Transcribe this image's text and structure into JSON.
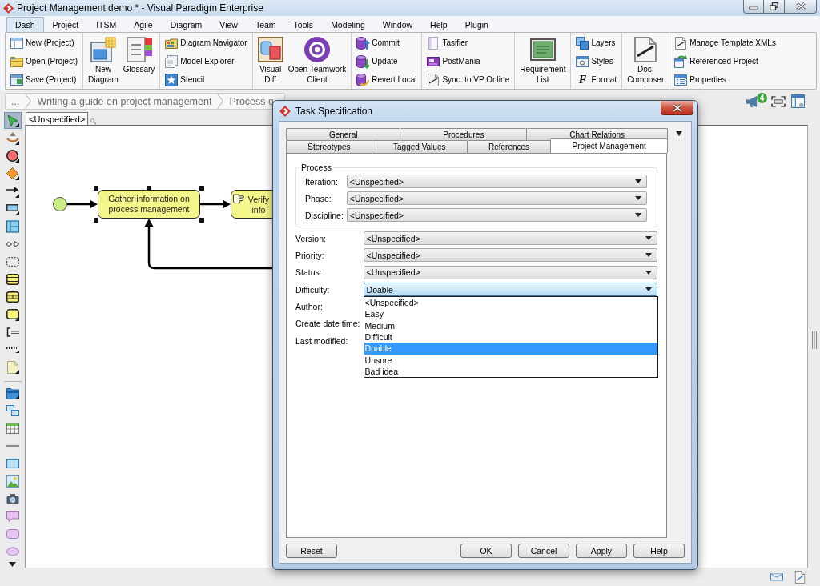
{
  "window": {
    "title": "Project Management demo * - Visual Paradigm Enterprise"
  },
  "menu_tabs": [
    {
      "label": "Dash",
      "selected": true
    },
    {
      "label": "Project",
      "selected": false
    },
    {
      "label": "ITSM",
      "selected": false
    },
    {
      "label": "Agile",
      "selected": false
    },
    {
      "label": "Diagram",
      "selected": false
    },
    {
      "label": "View",
      "selected": false
    },
    {
      "label": "Team",
      "selected": false
    },
    {
      "label": "Tools",
      "selected": false
    },
    {
      "label": "Modeling",
      "selected": false
    },
    {
      "label": "Window",
      "selected": false
    },
    {
      "label": "Help",
      "selected": false
    },
    {
      "label": "Plugin",
      "selected": false
    }
  ],
  "ribbon": {
    "groups": [
      {
        "items": [
          {
            "kind": "small",
            "label": "New (Project)"
          },
          {
            "kind": "small",
            "label": "Open (Project)"
          },
          {
            "kind": "small",
            "label": "Save (Project)"
          }
        ]
      },
      {
        "items": [
          {
            "kind": "large",
            "label": "New\nDiagram"
          },
          {
            "kind": "large",
            "label": "Glossary"
          }
        ]
      },
      {
        "items": [
          {
            "kind": "small",
            "label": "Diagram Navigator"
          },
          {
            "kind": "small",
            "label": "Model Explorer"
          },
          {
            "kind": "small",
            "label": "Stencil"
          }
        ]
      },
      {
        "items": [
          {
            "kind": "large",
            "label": "Visual\nDiff"
          },
          {
            "kind": "large",
            "label": "Open Teamwork\nClient"
          }
        ]
      },
      {
        "items": [
          {
            "kind": "small",
            "label": "Commit"
          },
          {
            "kind": "small",
            "label": "Update"
          },
          {
            "kind": "small",
            "label": "Revert Local"
          }
        ]
      },
      {
        "items": [
          {
            "kind": "small",
            "label": "Tasifier"
          },
          {
            "kind": "small",
            "label": "PostMania"
          },
          {
            "kind": "small",
            "label": "Sync. to VP Online"
          }
        ]
      },
      {
        "items": [
          {
            "kind": "large",
            "label": "Requirement\nList"
          }
        ]
      },
      {
        "items": [
          {
            "kind": "small",
            "label": "Layers"
          },
          {
            "kind": "small",
            "label": "Styles"
          },
          {
            "kind": "small",
            "label": "Format",
            "glyph": "F"
          }
        ]
      },
      {
        "items": [
          {
            "kind": "large",
            "label": "Doc.\nComposer"
          }
        ]
      },
      {
        "items": [
          {
            "kind": "small",
            "label": "Manage Template XMLs"
          },
          {
            "kind": "small",
            "label": "Referenced Project"
          },
          {
            "kind": "small",
            "label": "Properties"
          }
        ]
      }
    ]
  },
  "breadcrumb": [
    {
      "label": "..."
    },
    {
      "label": "Writing a guide on project management"
    },
    {
      "label": "Process o"
    }
  ],
  "notifications": {
    "badge": "4"
  },
  "palette": [
    {
      "selected": true
    },
    {
      "selected": false
    },
    {
      "selected": false
    },
    {
      "selected": false
    },
    {
      "selected": false
    },
    {
      "selected": false
    },
    {
      "selected": false
    },
    {
      "selected": false
    },
    {
      "selected": false
    },
    {
      "selected": false
    },
    {
      "selected": false
    },
    {
      "selected": false
    },
    {
      "selected": false
    },
    {
      "selected": false
    },
    {
      "selected": false
    },
    {
      "selected": false
    },
    {
      "selected": false
    },
    {
      "selected": false
    },
    {
      "selected": false
    },
    {
      "selected": false
    },
    {
      "selected": false
    },
    {
      "selected": false
    },
    {
      "selected": false
    },
    {
      "selected": false
    },
    {
      "selected": false
    }
  ],
  "diagram": {
    "owner_tab": "<Unspecified>",
    "nodes": [
      {
        "kind": "start"
      },
      {
        "kind": "task",
        "label": "Gather information on process management",
        "selected": true
      },
      {
        "kind": "manual_task",
        "label": "Verify info",
        "selected": false
      }
    ]
  },
  "dialog": {
    "title": "Task Specification",
    "tab_rows": [
      [
        {
          "label": "General",
          "selected": false
        },
        {
          "label": "Procedures",
          "selected": false
        },
        {
          "label": "Chart Relations",
          "selected": false
        }
      ],
      [
        {
          "label": "Stereotypes",
          "selected": false
        },
        {
          "label": "Tagged Values",
          "selected": false
        },
        {
          "label": "References",
          "selected": false
        },
        {
          "label": "Project Management",
          "selected": true
        }
      ]
    ],
    "process": {
      "legend": "Process",
      "fields": [
        {
          "label": "Iteration:",
          "value": "<Unspecified>"
        },
        {
          "label": "Phase:",
          "value": "<Unspecified>"
        },
        {
          "label": "Discipline:",
          "value": "<Unspecified>"
        }
      ]
    },
    "fields": [
      {
        "kind": "combo",
        "label": "Version:",
        "value": "<Unspecified>",
        "expanded": false
      },
      {
        "kind": "combo",
        "label": "Priority:",
        "value": "<Unspecified>",
        "expanded": false
      },
      {
        "kind": "combo",
        "label": "Status:",
        "value": "<Unspecified>",
        "expanded": false
      },
      {
        "kind": "combo",
        "label": "Difficulty:",
        "value": "Doable",
        "expanded": true,
        "options": [
          {
            "label": "<Unspecified>",
            "selected": false
          },
          {
            "label": "Easy",
            "selected": false
          },
          {
            "label": "Medium",
            "selected": false
          },
          {
            "label": "Difficult",
            "selected": false
          },
          {
            "label": "Doable",
            "selected": true
          },
          {
            "label": "Unsure",
            "selected": false
          },
          {
            "label": "Bad idea",
            "selected": false
          }
        ]
      },
      {
        "kind": "text",
        "label": "Author:"
      },
      {
        "kind": "text",
        "label": "Create date time:"
      },
      {
        "kind": "text",
        "label": "Last modified:"
      }
    ],
    "reset_button": "Reset",
    "buttons": [
      "OK",
      "Cancel",
      "Apply",
      "Help"
    ]
  }
}
